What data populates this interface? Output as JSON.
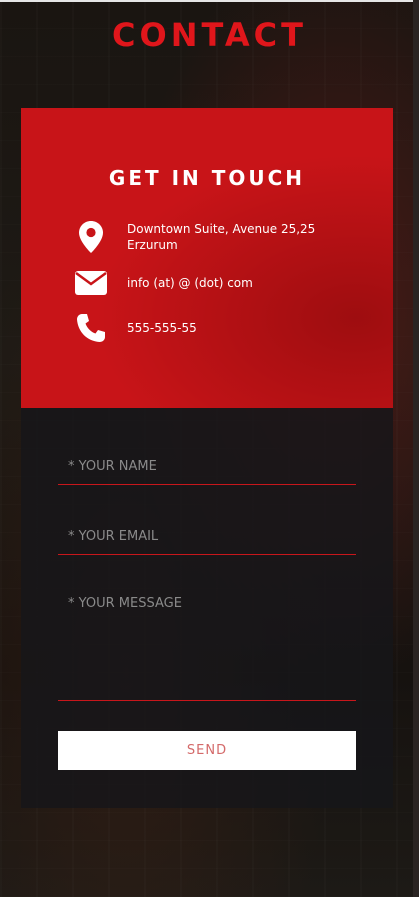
{
  "page": {
    "title": "CONTACT"
  },
  "info": {
    "heading": "GET IN TOUCH",
    "address_line1": "Downtown Suite, Avenue 25,25",
    "address_line2": "Erzurum",
    "email": "info (at) @ (dot) com",
    "phone": "555-555-55",
    "icons": {
      "address": "map-marker-icon",
      "email": "envelope-icon",
      "phone": "phone-icon"
    }
  },
  "form": {
    "name_placeholder": "* YOUR NAME",
    "email_placeholder": "* YOUR EMAIL",
    "message_placeholder": "* YOUR MESSAGE",
    "send_label": "SEND"
  },
  "colors": {
    "accent": "#c81418",
    "title": "#e0161b",
    "panel_dark": "#16161a",
    "button_bg": "#ffffff",
    "button_text": "#d46a6a"
  }
}
